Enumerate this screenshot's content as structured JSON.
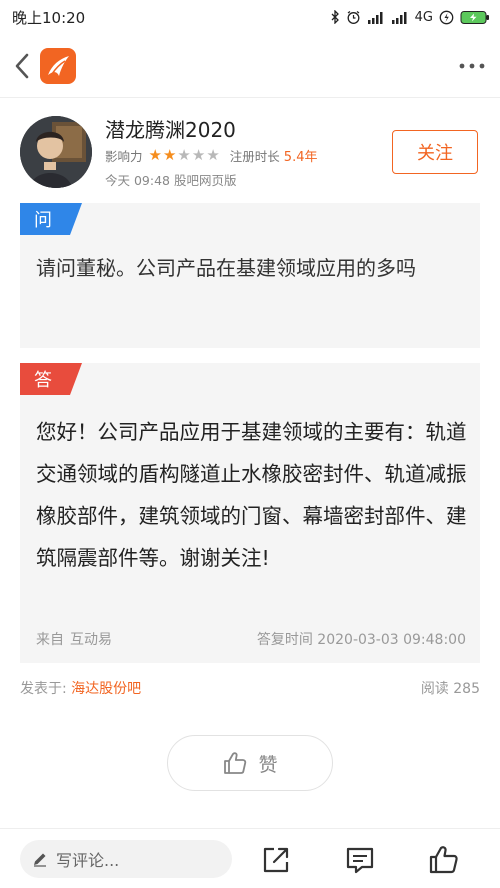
{
  "status_bar": {
    "time": "晚上10:20",
    "network": "4G",
    "icons": [
      "bluetooth-icon",
      "alarm-icon",
      "signal-icon",
      "signal-icon",
      "charging-icon",
      "battery-icon"
    ]
  },
  "header": {
    "icons": [
      "back-icon",
      "app-logo-icon",
      "more-icon"
    ]
  },
  "author": {
    "name": "潜龙腾渊2020",
    "influence_label": "影响力",
    "rating": 2,
    "rating_max": 5,
    "reg_label": "注册时长",
    "reg_value": "5.4年",
    "post_time": "今天 09:48 股吧网页版",
    "follow_label": "关注"
  },
  "question": {
    "tag": "问",
    "tag_color": "#2f86e8",
    "text": "请问董秘。公司产品在基建领域应用的多吗"
  },
  "answer": {
    "tag": "答",
    "tag_color": "#e84c3d",
    "text": "您好！公司产品应用于基建领域的主要有：轨道交通领域的盾构隧道止水橡胶密封件、轨道减振橡胶部件，建筑领域的门窗、幕墙密封部件、建筑隔震部件等。谢谢关注!",
    "source_label": "来自",
    "source_value": "互动易",
    "reply_time": "答复时间 2020-03-03 09:48:00"
  },
  "footer_meta": {
    "posted_label": "发表于:",
    "bar_name": "海达股份吧",
    "read_label": "阅读",
    "read_count": "285"
  },
  "like": {
    "label": "赞"
  },
  "bottom_bar": {
    "comment_placeholder": "写评论..."
  },
  "colors": {
    "accent": "#f26522",
    "star": "#f58d1e"
  }
}
